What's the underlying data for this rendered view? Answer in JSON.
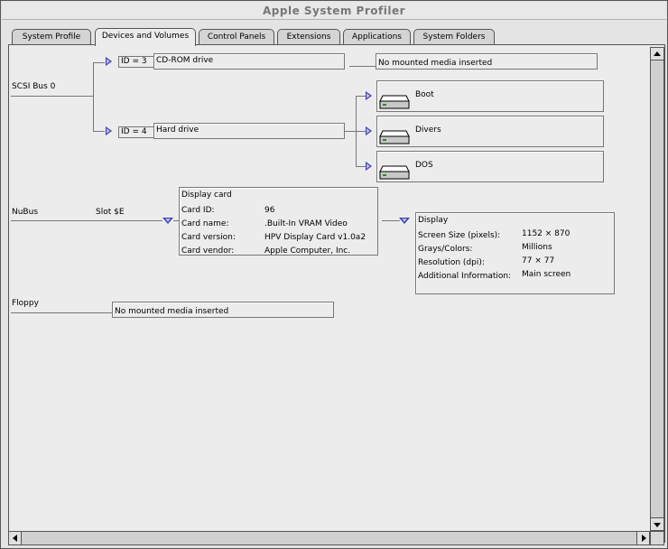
{
  "window": {
    "title": "Apple System Profiler"
  },
  "tabs": [
    {
      "label": "System Profile"
    },
    {
      "label": "Devices and Volumes"
    },
    {
      "label": "Control Panels"
    },
    {
      "label": "Extensions"
    },
    {
      "label": "Applications"
    },
    {
      "label": "System Folders"
    }
  ],
  "scsi": {
    "bus_label": "SCSI Bus 0",
    "devices": [
      {
        "id_label": "ID = 3",
        "name": "CD-ROM drive",
        "status": "No mounted media inserted"
      },
      {
        "id_label": "ID = 4",
        "name": "Hard drive"
      }
    ],
    "volumes": [
      {
        "name": "Boot",
        "icon": "hard-disk-icon"
      },
      {
        "name": "Divers",
        "icon": "hard-disk-icon"
      },
      {
        "name": "DOS",
        "icon": "hard-disk-icon"
      }
    ]
  },
  "nubus": {
    "bus_label": "NuBus",
    "slot_label": "Slot $E",
    "card": {
      "title": "Display card",
      "rows": [
        {
          "label": "Card ID:",
          "value": "96"
        },
        {
          "label": "Card name:",
          "value": ".Built-In VRAM Video"
        },
        {
          "label": "Card version:",
          "value": "HPV Display Card v1.0a2"
        },
        {
          "label": "Card vendor:",
          "value": "Apple Computer, Inc."
        }
      ]
    },
    "display": {
      "title": "Display",
      "rows": [
        {
          "label": "Screen Size (pixels):",
          "value": "1152 × 870"
        },
        {
          "label": "Grays/Colors:",
          "value": "Millions"
        },
        {
          "label": "Resolution (dpi):",
          "value": "77 × 77"
        },
        {
          "label": "Additional Information:",
          "value": "Main screen"
        }
      ]
    }
  },
  "floppy": {
    "bus_label": "Floppy",
    "status": "No mounted media inserted"
  },
  "colors": {
    "disclosure": "#3a3ab8",
    "window_bg": "#ececec"
  }
}
